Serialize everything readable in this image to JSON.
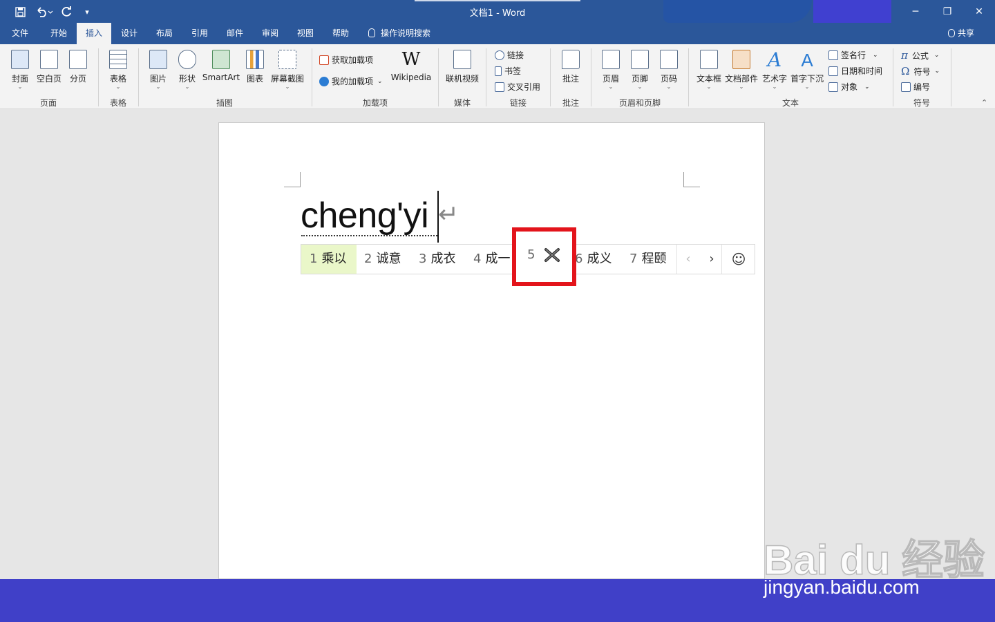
{
  "window": {
    "title": "文档1  -  Word"
  },
  "quick_access": {
    "save_icon": "save-icon",
    "undo_icon": "undo-icon",
    "redo_icon": "redo-icon",
    "customize_icon": "customize-qat-icon"
  },
  "window_controls": {
    "minimize": "─",
    "restore": "❐",
    "close": "✕"
  },
  "tabs": [
    {
      "label": "文件"
    },
    {
      "label": "开始"
    },
    {
      "label": "插入"
    },
    {
      "label": "设计"
    },
    {
      "label": "布局"
    },
    {
      "label": "引用"
    },
    {
      "label": "邮件"
    },
    {
      "label": "审阅"
    },
    {
      "label": "视图"
    },
    {
      "label": "帮助"
    }
  ],
  "active_tab": "插入",
  "tell_me": "操作说明搜索",
  "share": "共享",
  "ribbon": {
    "pages": {
      "cover": "封面",
      "blank": "空白页",
      "break": "分页",
      "group": "页面"
    },
    "tables": {
      "table": "表格",
      "group": "表格"
    },
    "illustrations": {
      "picture": "图片",
      "shapes": "形状",
      "smartart": "SmartArt",
      "chart": "图表",
      "screenshot": "屏幕截图",
      "group": "插图"
    },
    "addins": {
      "get": "获取加载项",
      "mine": "我的加载项",
      "wikipedia": "Wikipedia",
      "group": "加载项"
    },
    "media": {
      "video": "联机视频",
      "group": "媒体"
    },
    "links": {
      "link": "链接",
      "bookmark": "书签",
      "crossref": "交叉引用",
      "group": "链接"
    },
    "comments": {
      "comment": "批注",
      "group": "批注"
    },
    "header_footer": {
      "header": "页眉",
      "footer": "页脚",
      "page_number": "页码",
      "group": "页眉和页脚"
    },
    "text": {
      "textbox": "文本框",
      "quickparts": "文档部件",
      "wordart": "艺术字",
      "dropcap": "首字下沉",
      "signature": "签名行",
      "datetime": "日期和时间",
      "object": "对象",
      "group": "文本"
    },
    "symbols": {
      "equation": "公式",
      "symbol": "符号",
      "number": "编号",
      "group": "符号"
    }
  },
  "document": {
    "typed_text": "cheng'yi",
    "pilcrow": "↵"
  },
  "ime": {
    "candidates": [
      {
        "num": "1",
        "text": "乘以"
      },
      {
        "num": "2",
        "text": "诚意"
      },
      {
        "num": "3",
        "text": "成衣"
      },
      {
        "num": "4",
        "text": "成一"
      },
      {
        "num": "5",
        "text": ""
      },
      {
        "num": "6",
        "text": "成义"
      },
      {
        "num": "7",
        "text": "程颐"
      }
    ],
    "prev": "‹",
    "next": "›",
    "emoji": "☺",
    "selected_index": 0
  },
  "watermark": {
    "brand": "Bai du 经验",
    "url": "jingyan.baidu.com"
  },
  "colors": {
    "titlebar": "#2b579a",
    "highlight": "#e3141b",
    "selected_candidate": "#eaf7c9",
    "bottom_bar": "#4040c8"
  }
}
